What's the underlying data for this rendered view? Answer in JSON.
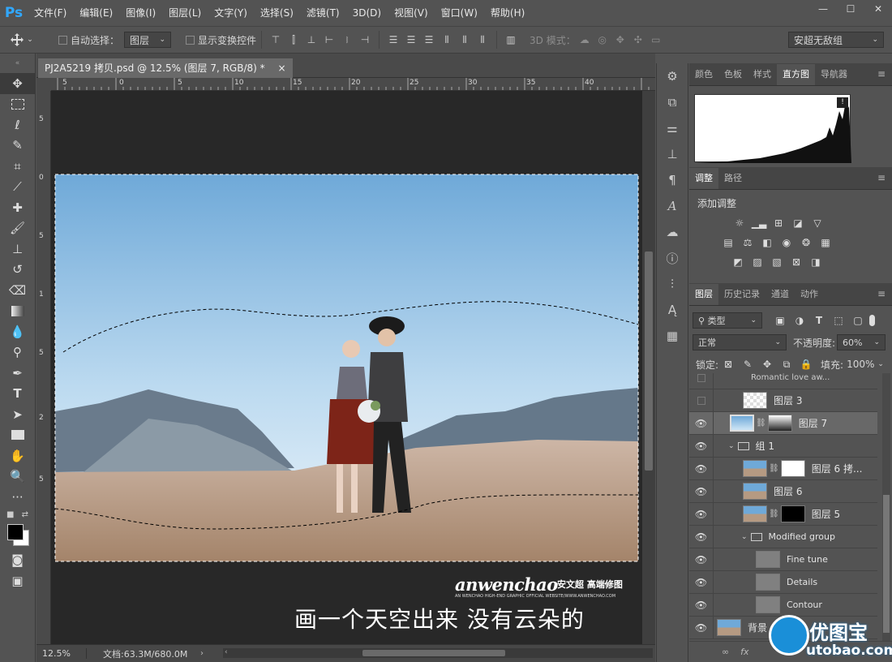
{
  "app": {
    "logo": "Ps"
  },
  "menu": [
    "文件(F)",
    "编辑(E)",
    "图像(I)",
    "图层(L)",
    "文字(Y)",
    "选择(S)",
    "滤镜(T)",
    "3D(D)",
    "视图(V)",
    "窗口(W)",
    "帮助(H)"
  ],
  "window_controls": [
    "—",
    "☐",
    "✕"
  ],
  "options": {
    "auto_select_label": "自动选择：",
    "auto_select_value": "图层",
    "show_transform_label": "显示变换控件",
    "mode_3d_label": "3D 模式：",
    "workspace": "安超无敌组"
  },
  "document": {
    "tab_title": "PJ2A5219 拷贝.psd @ 12.5% (图层 7, RGB/8) *",
    "close_icon": "×",
    "zoom": "12.5%",
    "doc_size": "文档:63.3M/680.0M",
    "ruler_h": [
      "5",
      "0",
      "5",
      "10",
      "15",
      "20",
      "25",
      "30",
      "35",
      "40"
    ],
    "ruler_v": [
      "5",
      "0",
      "5",
      "1",
      "5",
      "2",
      "5"
    ]
  },
  "watermark": {
    "brand": "anwenchao",
    "brand_cn": "安文超 高端修图",
    "tagline": "AN WENCHAO HIGH-END GRAPHIC OFFICIAL WEBSITE/WWW.ANWENCHAO.COM",
    "caption": "画一个天空出来  没有云朵的"
  },
  "histogram_panel": {
    "tabs": [
      "颜色",
      "色板",
      "样式",
      "直方图",
      "导航器"
    ],
    "active_tab": "直方图",
    "warning_icon": "!"
  },
  "adjustments_panel": {
    "tabs": [
      "调整",
      "路径"
    ],
    "active_tab": "调整",
    "title": "添加调整"
  },
  "layers_panel": {
    "tabs": [
      "图层",
      "历史记录",
      "通道",
      "动作"
    ],
    "active_tab": "图层",
    "filter_kind": "类型",
    "blend_mode": "正常",
    "opacity_label": "不透明度:",
    "opacity_value": "60%",
    "lock_label": "锁定:",
    "fill_label": "填充:",
    "fill_value": "100%",
    "layers": [
      {
        "name": "Romantic love  aw..."
      },
      {
        "name": "图层 3"
      },
      {
        "name": "图层 7"
      },
      {
        "name": "组 1"
      },
      {
        "name": "图层 6 拷..."
      },
      {
        "name": "图层 6"
      },
      {
        "name": "图层 5"
      },
      {
        "name": "Modified group"
      },
      {
        "name": "Fine tune"
      },
      {
        "name": "Details"
      },
      {
        "name": "Contour"
      },
      {
        "name": "背景"
      }
    ],
    "bottom_icons": [
      "∞",
      "fx"
    ]
  },
  "site_logo": {
    "cn": "优图宝",
    "en": "utobao.com"
  },
  "colors": {
    "accent_ps": "#31a8ff",
    "panel": "#535353",
    "canvas": "#282828",
    "selected_row": "#686868"
  }
}
